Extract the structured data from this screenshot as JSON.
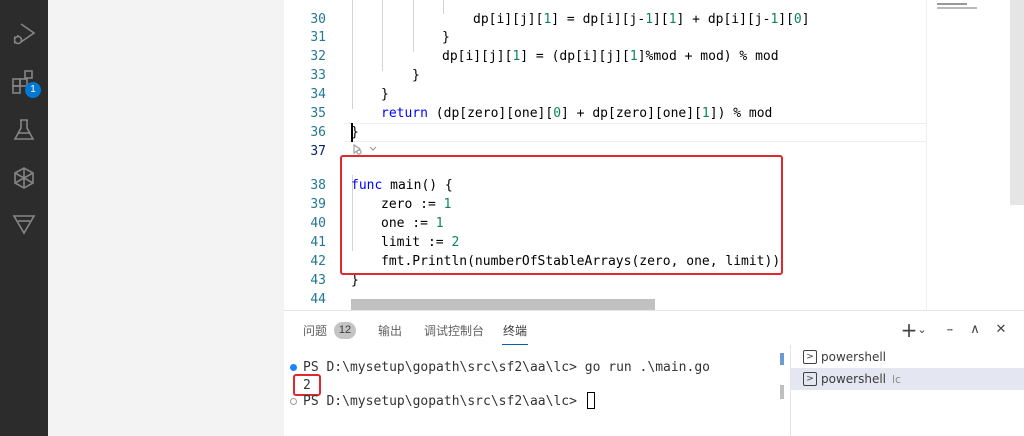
{
  "activity_bar": {
    "icons": [
      "run-debug-icon",
      "extensions-icon",
      "testing-icon",
      "remote-icon",
      "gitlens-icon"
    ],
    "extensions_badge": "1"
  },
  "editor": {
    "lines": [
      {
        "n": "30",
        "code": "            dp[i][j][1] = dp[i][j-1][1] + dp[i][j-1][0]"
      },
      {
        "n": "31",
        "code": "        }"
      },
      {
        "n": "32",
        "code": "        dp[i][j][1] = (dp[i][j][1]%mod + mod) % mod"
      },
      {
        "n": "33",
        "code": "    }"
      },
      {
        "n": "34",
        "code": "}"
      },
      {
        "n": "35",
        "code": "return (dp[zero][one][0] + dp[zero][one][1]) % mod"
      },
      {
        "n": "36",
        "code": "}"
      },
      {
        "n": "37",
        "code": ""
      },
      {
        "n": "38",
        "code": "func main() {"
      },
      {
        "n": "39",
        "code": "zero := 1"
      },
      {
        "n": "40",
        "code": "one := 1"
      },
      {
        "n": "41",
        "code": "limit := 2"
      },
      {
        "n": "42",
        "code": "fmt.Println(numberOfStableArrays(zero, one, limit))"
      },
      {
        "n": "43",
        "code": "}"
      },
      {
        "n": "44",
        "code": ""
      }
    ]
  },
  "panel": {
    "tabs": [
      {
        "label": "问题"
      },
      {
        "label": "输出"
      },
      {
        "label": "调试控制台"
      },
      {
        "label": "终端"
      }
    ],
    "problems_count": "12",
    "actions": {
      "add": "+",
      "dropdown": "⌄",
      "more": "···",
      "maximize": "∧",
      "close": "✕"
    },
    "terminal": {
      "prompt1": "PS D:\\mysetup\\gopath\\src\\sf2\\aa\\lc> ",
      "cmd": "go run .\\main.go",
      "output": "2",
      "prompt2": "PS D:\\mysetup\\gopath\\src\\sf2\\aa\\lc> "
    },
    "terminal_list": [
      {
        "label": "powershell",
        "sub": ""
      },
      {
        "label": "powershell",
        "sub": "lc"
      }
    ]
  }
}
